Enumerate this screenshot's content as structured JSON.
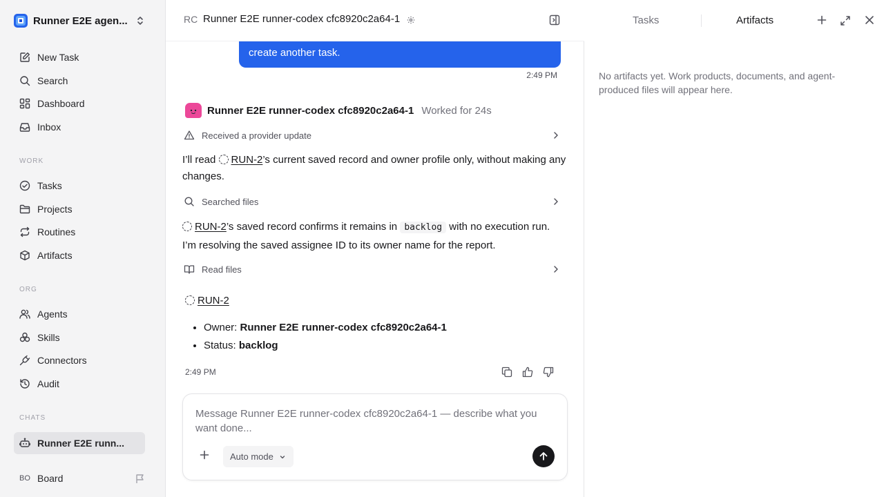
{
  "sidebar": {
    "workspace_name": "Runner E2E agen...",
    "primary_nav": [
      {
        "label": "New Task",
        "icon": "edit-icon"
      },
      {
        "label": "Search",
        "icon": "search-icon"
      },
      {
        "label": "Dashboard",
        "icon": "dashboard-icon"
      },
      {
        "label": "Inbox",
        "icon": "inbox-icon"
      }
    ],
    "work_label": "WORK",
    "work_nav": [
      {
        "label": "Tasks",
        "icon": "check-circle-icon"
      },
      {
        "label": "Projects",
        "icon": "folder-icon"
      },
      {
        "label": "Routines",
        "icon": "repeat-icon"
      },
      {
        "label": "Artifacts",
        "icon": "box-icon"
      }
    ],
    "org_label": "ORG",
    "org_nav": [
      {
        "label": "Agents",
        "icon": "users-icon"
      },
      {
        "label": "Skills",
        "icon": "skills-icon"
      },
      {
        "label": "Connectors",
        "icon": "plug-icon"
      },
      {
        "label": "Audit",
        "icon": "history-icon"
      }
    ],
    "chats_label": "CHATS",
    "chats": [
      {
        "label": "Runner E2E runn...",
        "icon": "bot-icon",
        "active": true
      }
    ],
    "board": {
      "initials": "BO",
      "label": "Board"
    }
  },
  "header": {
    "badge": "RC",
    "title": "Runner E2E runner-codex cfc8920c2a64-1"
  },
  "conversation": {
    "user_message_tail": "create another task.",
    "user_time": "2:49 PM",
    "agent": {
      "name": "Runner E2E runner-codex cfc8920c2a64-1",
      "worked": "Worked for 24s"
    },
    "tool_rows": [
      {
        "label": "Received a provider update",
        "icon": "alert-triangle-icon"
      },
      {
        "label": "Searched files",
        "icon": "search-icon"
      },
      {
        "label": "Read files",
        "icon": "book-icon"
      }
    ],
    "para1": {
      "pre": "I’ll read",
      "link": "RUN-2",
      "post": "’s current saved record and owner profile only, without making any changes."
    },
    "para2": {
      "link": "RUN-2",
      "mid": "’s saved record confirms it remains in",
      "code": "backlog",
      "post": "with no execution run. I’m resolving the saved assignee ID to its owner name for the report."
    },
    "result": {
      "title": "RUN-2",
      "owner_label": "Owner:",
      "owner_value": "Runner E2E runner-codex cfc8920c2a64-1",
      "status_label": "Status:",
      "status_value": "backlog"
    },
    "time": "2:49 PM"
  },
  "composer": {
    "placeholder": "Message Runner E2E runner-codex cfc8920c2a64-1 — describe what you want done...",
    "value": "",
    "mode": "Auto mode"
  },
  "right_panel": {
    "tabs": [
      {
        "label": "Tasks",
        "active": false
      },
      {
        "label": "Artifacts",
        "active": true
      }
    ],
    "empty_message": "No artifacts yet. Work products, documents, and agent-produced files will appear here."
  },
  "colors": {
    "accent": "#2563eb",
    "sidebar_bg": "#f4f4f5",
    "agent_avatar": "#ec4899",
    "send_button": "#18181b"
  }
}
